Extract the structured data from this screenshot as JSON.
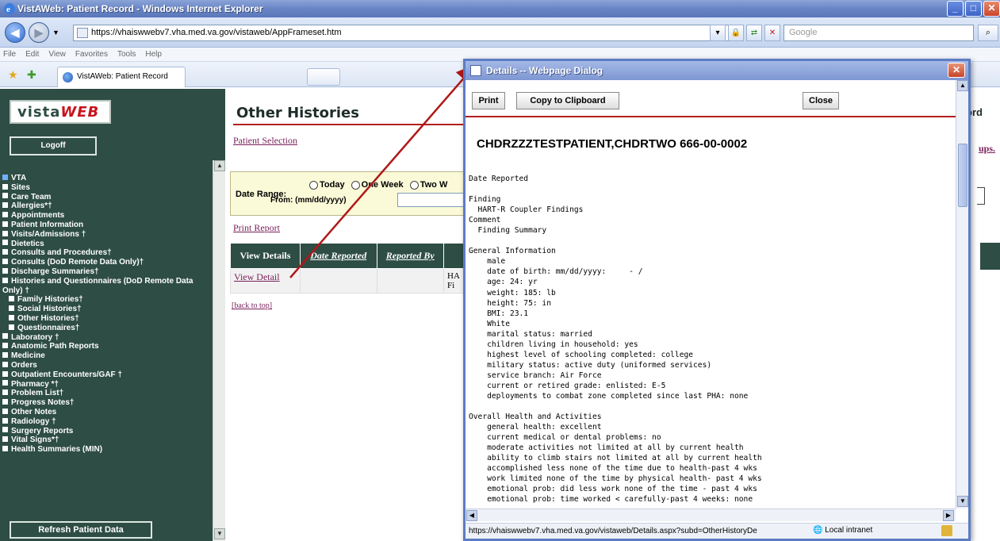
{
  "window": {
    "title": "VistAWeb: Patient Record - Windows Internet Explorer",
    "url": "https://vhaiswwebv7.vha.med.va.gov/vistaweb/AppFrameset.htm",
    "search_placeholder": "Google"
  },
  "menu": [
    "File",
    "Edit",
    "View",
    "Favorites",
    "Tools",
    "Help"
  ],
  "tab": {
    "label": "VistAWeb: Patient Record"
  },
  "sidebar": {
    "logo_a": "vista",
    "logo_b": "WEB",
    "logoff": "Logoff",
    "items": [
      {
        "label": "VTA",
        "level": 0
      },
      {
        "label": "Sites",
        "level": 0
      },
      {
        "label": "Care Team",
        "level": 0
      },
      {
        "label": "Allergies*†",
        "level": 0
      },
      {
        "label": "Appointments",
        "level": 0
      },
      {
        "label": "Patient Information",
        "level": 0
      },
      {
        "label": "Visits/Admissions †",
        "level": 0
      },
      {
        "label": "Dietetics",
        "level": 0
      },
      {
        "label": "Consults and Procedures†",
        "level": 0
      },
      {
        "label": "Consults (DoD Remote Data Only)†",
        "level": 0
      },
      {
        "label": "Discharge Summaries†",
        "level": 0
      },
      {
        "label": "Histories and Questionnaires (DoD Remote Data Only) †",
        "level": 0
      },
      {
        "label": "Family Histories†",
        "level": 1
      },
      {
        "label": "Social Histories†",
        "level": 1
      },
      {
        "label": "Other Histories†",
        "level": 1
      },
      {
        "label": "Questionnaires†",
        "level": 1
      },
      {
        "label": "Laboratory †",
        "level": 0
      },
      {
        "label": "Anatomic Path Reports",
        "level": 0
      },
      {
        "label": "Medicine",
        "level": 0
      },
      {
        "label": "Orders",
        "level": 0
      },
      {
        "label": "Outpatient Encounters/GAF †",
        "level": 0
      },
      {
        "label": "Pharmacy *†",
        "level": 0
      },
      {
        "label": "Problem List†",
        "level": 0
      },
      {
        "label": "Progress Notes†",
        "level": 0
      },
      {
        "label": "Other Notes",
        "level": 0
      },
      {
        "label": "Radiology †",
        "level": 0
      },
      {
        "label": "Surgery Reports",
        "level": 0
      },
      {
        "label": "Vital Signs*†",
        "level": 0
      },
      {
        "label": "Health Summaries (MIN)",
        "level": 0
      }
    ],
    "refresh": "Refresh Patient Data"
  },
  "main": {
    "title": "Other Histories",
    "patient_selection": "Patient Selection",
    "date_range_label": "Date Range:",
    "radio_today": "Today",
    "radio_one_week": "One Week",
    "radio_two_w": "Two W",
    "from_label": "From: (mm/dd/yyyy)",
    "print_report": "Print Report",
    "table": {
      "headers": [
        "View Details",
        "Date Reported",
        "Reported By"
      ],
      "view_detail": "View Detail",
      "frag": "HA\nFi"
    },
    "back_to_top": "[back to top]",
    "right_frag1": "ord",
    "right_frag2": "ups."
  },
  "dialog": {
    "title": "Details -- Webpage Dialog",
    "print": "Print",
    "copy": "Copy to Clipboard",
    "close": "Close",
    "patient": "CHDRZZZTESTPATIENT,CHDRTWO  666-00-0002",
    "report": "Date Reported\n\nFinding\n  HART-R Coupler Findings\nComment\n  Finding Summary\n\nGeneral Information\n    male\n    date of birth: mm/dd/yyyy:     - /\n    age: 24: yr\n    weight: 185: lb\n    height: 75: in\n    BMI: 23.1\n    White\n    marital status: married\n    children living in household: yes\n    highest level of schooling completed: college\n    military status: active duty (uniformed services)\n    service branch: Air Force\n    current or retired grade: enlisted: E-5\n    deployments to combat zone completed since last PHA: none\n\nOverall Health and Activities\n    general health: excellent\n    current medical or dental problems: no\n    moderate activities not limited at all by current health\n    ability to climb stairs not limited at all by current health\n    accomplished less none of the time due to health-past 4 wks\n    work limited none of the time by physical health- past 4 wks\n    emotional prob: did less work none of the time - past 4 wks\n    emotional prob: time worked < carefully-past 4 weeks: none",
    "status_url": "https://vhaiswwebv7.vha.med.va.gov/vistaweb/Details.aspx?subd=OtherHistoryDe",
    "status_zone": "Local intranet"
  }
}
